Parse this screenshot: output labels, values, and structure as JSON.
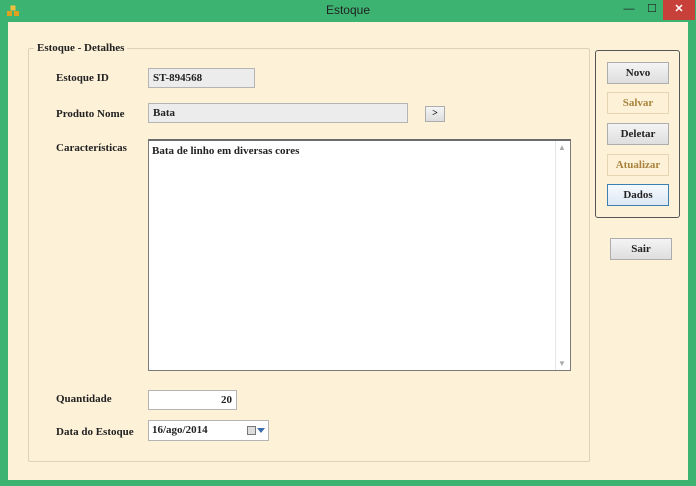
{
  "window": {
    "title": "Estoque",
    "min_glyph": "—",
    "max_glyph": "☐",
    "close_glyph": "✕"
  },
  "group": {
    "title": "Estoque - Detalhes"
  },
  "form": {
    "id_label": "Estoque ID",
    "id_value": "ST-894568",
    "produto_label": "Produto Nome",
    "produto_value": "Bata",
    "browse_label": ">",
    "caracteristicas_label": "Características",
    "caracteristicas_value": "Bata de linho em diversas cores",
    "quantidade_label": "Quantidade",
    "quantidade_value": "20",
    "data_label": "Data do Estoque",
    "data_value": "16/ago/2014"
  },
  "buttons": {
    "novo": "Novo",
    "salvar": "Salvar",
    "deletar": "Deletar",
    "atualizar": "Atualizar",
    "dados": "Dados",
    "sair": "Sair"
  },
  "icons": {
    "app": "app-icon",
    "calendar": "calendar-icon"
  },
  "colors": {
    "titlebar": "#3cb371",
    "client_bg": "#fdf1d8",
    "disabled_text": "#a9833d"
  }
}
